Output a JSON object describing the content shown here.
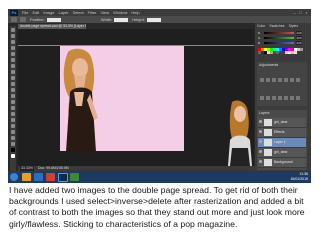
{
  "app": {
    "menu": [
      "File",
      "Edit",
      "Image",
      "Layer",
      "Select",
      "Filter",
      "View",
      "Window",
      "Help"
    ],
    "window_controls": [
      "–",
      "□",
      "×"
    ],
    "logo": "Ps",
    "options": {
      "feather_label": "Feather:",
      "width_label": "Width:",
      "height_label": "Height:"
    },
    "document_tab": "double page spread.psd @ 33.3% (Layer 6, RGB/8*)",
    "panel_tabs": [
      "Color",
      "Swatches",
      "Styles"
    ],
    "color_sliders": [
      {
        "label": "R",
        "value": "239",
        "color": "#e05050"
      },
      {
        "label": "G",
        "value": "204",
        "color": "#50c050"
      },
      {
        "label": "B",
        "value": "226",
        "color": "#5070e0"
      }
    ],
    "swatch_colors": [
      "#ff0000",
      "#ff8000",
      "#ffff00",
      "#80ff00",
      "#00ff00",
      "#00ff80",
      "#00ffff",
      "#0080ff",
      "#0000ff",
      "#8000ff",
      "#ff00ff",
      "#ff0080",
      "#ffffff",
      "#cccccc",
      "#999999",
      "#666666",
      "#333333",
      "#000000",
      "#f4cde6",
      "#c0a080",
      "#804020",
      "#408040",
      "#204080",
      "#802040",
      "#ffc0c0",
      "#c0ffc0",
      "#c0c0ff",
      "#ffe0a0"
    ],
    "adjustments_title": "Adjustments",
    "layers_title": "Layers",
    "layers": [
      {
        "name": "girl_dear",
        "selected": false
      },
      {
        "name": "Effects",
        "selected": false
      },
      {
        "name": "Layer 1",
        "selected": true
      },
      {
        "name": "girl_dear",
        "selected": false
      },
      {
        "name": "Background",
        "selected": false
      }
    ],
    "zoom": "33.33%",
    "doc_info": "Doc: 99.6M/245.9M",
    "clock": "11:36",
    "date": "16/01/2015"
  },
  "caption": "I have added two images to the double page spread. To get rid of both their backgrounds I used select>inverse>delete after rasterization and added a bit of contrast to both the images so that they stand out more and just look more girly/flawless. Sticking to characteristics of a pop magazine.",
  "colors": {
    "canvas_pink": "#f4cde6",
    "guide": "#2fb3a6",
    "taskbar": "#1e3a60"
  },
  "icons": [
    "photoshop-logo",
    "minimize-icon",
    "maximize-icon",
    "close-icon",
    "eye-icon",
    "windows-start-icon"
  ]
}
